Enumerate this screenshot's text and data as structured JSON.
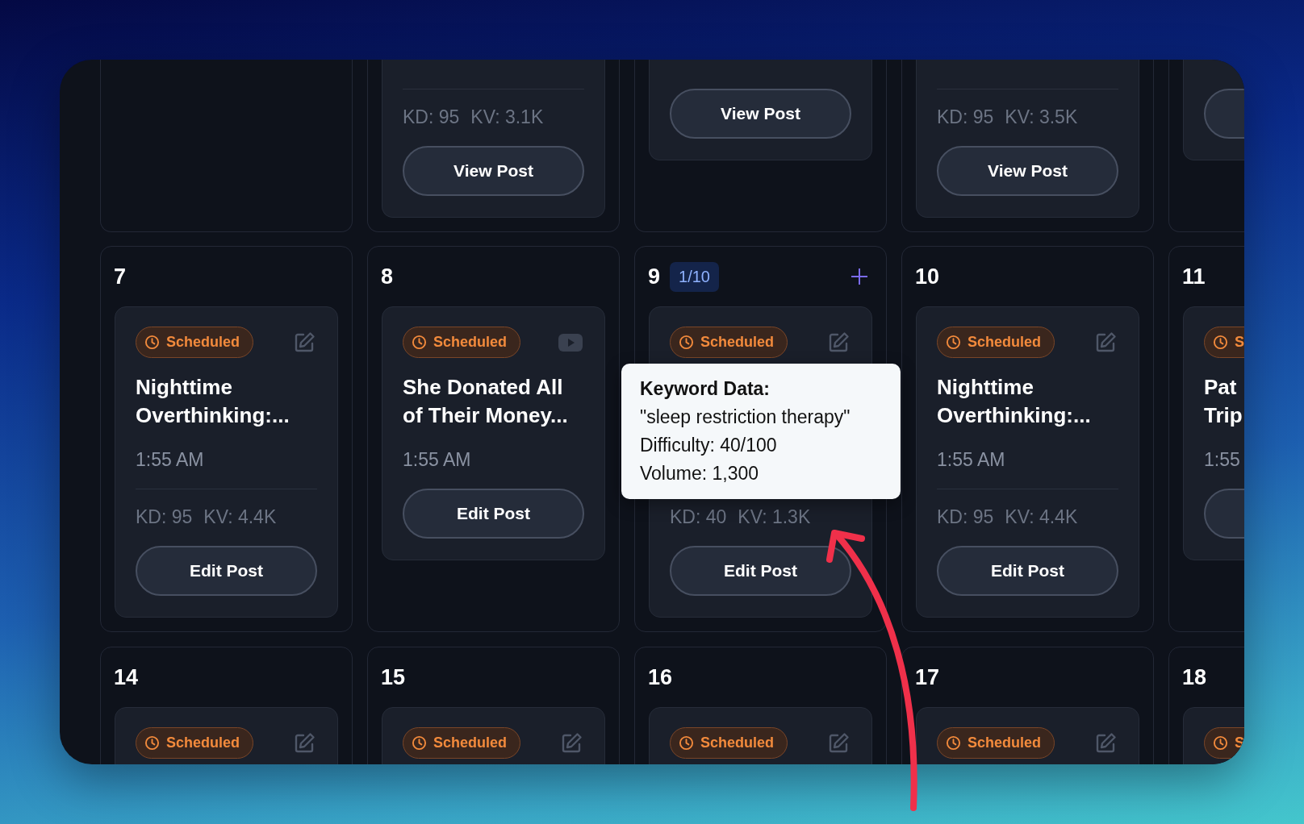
{
  "calendar": {
    "rows": [
      {
        "cells": [
          {},
          {
            "posts": [
              {
                "kd": "KD: 95",
                "kv": "KV: 3.1K",
                "button": "View Post"
              }
            ]
          },
          {
            "posts": [
              {
                "button": "View Post"
              }
            ]
          },
          {
            "posts": [
              {
                "kd": "KD: 95",
                "kv": "KV: 3.5K",
                "button": "View Post"
              }
            ]
          },
          {
            "posts": [
              {
                "button_cut": true
              }
            ]
          }
        ]
      },
      {
        "cells": [
          {
            "day": "7",
            "posts": [
              {
                "status": "Scheduled",
                "kind": "article",
                "title_lines": [
                  "Nighttime",
                  "Overthinking:..."
                ],
                "time": "1:55 AM",
                "kd": "KD: 95",
                "kv": "KV: 4.4K",
                "button": "Edit Post"
              }
            ]
          },
          {
            "day": "8",
            "posts": [
              {
                "status": "Scheduled",
                "kind": "video",
                "title_lines": [
                  "She Donated All",
                  "of Their Money..."
                ],
                "time": "1:55 AM",
                "button": "Edit Post"
              }
            ]
          },
          {
            "day": "9",
            "count": "1/10",
            "add": true,
            "posts": [
              {
                "status": "Scheduled",
                "kind": "article",
                "kd": "KD: 40",
                "kv": "KV: 1.3K",
                "button": "Edit Post"
              }
            ]
          },
          {
            "day": "10",
            "posts": [
              {
                "status": "Scheduled",
                "kind": "article",
                "title_lines": [
                  "Nighttime",
                  "Overthinking:..."
                ],
                "time": "1:55 AM",
                "kd": "KD: 95",
                "kv": "KV: 4.4K",
                "button": "Edit Post"
              }
            ]
          },
          {
            "day": "11",
            "posts": [
              {
                "status": "S",
                "title_lines": [
                  "Pat",
                  "Trip"
                ],
                "time": "1:55",
                "button_cut": true
              }
            ]
          }
        ]
      },
      {
        "cells": [
          {
            "day": "14",
            "posts": [
              {
                "status": "Scheduled",
                "kind": "article"
              }
            ]
          },
          {
            "day": "15",
            "posts": [
              {
                "status": "Scheduled",
                "kind": "article"
              }
            ]
          },
          {
            "day": "16",
            "posts": [
              {
                "status": "Scheduled",
                "kind": "article"
              }
            ]
          },
          {
            "day": "17",
            "posts": [
              {
                "status": "Scheduled",
                "kind": "article"
              }
            ]
          },
          {
            "day": "18",
            "posts": [
              {
                "status": "S"
              }
            ]
          }
        ]
      }
    ]
  },
  "tooltip": {
    "title": "Keyword Data:",
    "lines": [
      "\"sleep restriction therapy\"",
      "Difficulty: 40/100",
      "Volume: 1,300"
    ]
  },
  "annotation": {
    "arrow": true
  }
}
